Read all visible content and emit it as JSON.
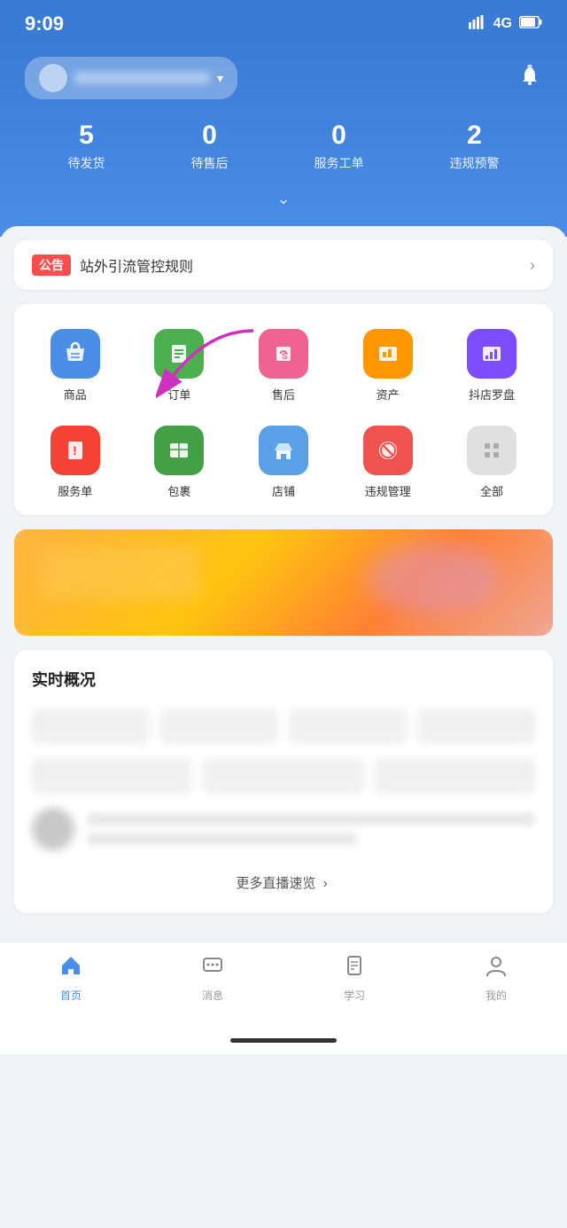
{
  "statusBar": {
    "time": "9:09",
    "network": "4G"
  },
  "header": {
    "storeName": "",
    "bellLabel": "通知",
    "stats": [
      {
        "num": "5",
        "label": "待发货"
      },
      {
        "num": "0",
        "label": "待售后"
      },
      {
        "num": "0",
        "label": "服务工单"
      },
      {
        "num": "2",
        "label": "违规预警"
      }
    ]
  },
  "announcement": {
    "badge": "公告",
    "text": "站外引流管控规则",
    "arrow": "›"
  },
  "menu": {
    "items": [
      {
        "id": "goods",
        "label": "商品",
        "iconColor": "icon-blue"
      },
      {
        "id": "orders",
        "label": "订单",
        "iconColor": "icon-green"
      },
      {
        "id": "aftersale",
        "label": "售后",
        "iconColor": "icon-pink"
      },
      {
        "id": "assets",
        "label": "资产",
        "iconColor": "icon-orange"
      },
      {
        "id": "compass",
        "label": "抖店罗盘",
        "iconColor": "icon-purple"
      },
      {
        "id": "service",
        "label": "服务单",
        "iconColor": "icon-red"
      },
      {
        "id": "parcel",
        "label": "包裹",
        "iconColor": "icon-green2"
      },
      {
        "id": "store",
        "label": "店铺",
        "iconColor": "icon-blue2"
      },
      {
        "id": "violation",
        "label": "违规管理",
        "iconColor": "icon-red2"
      },
      {
        "id": "all",
        "label": "全部",
        "iconColor": "icon-gray"
      }
    ]
  },
  "realtime": {
    "title": "实时概况"
  },
  "moreLive": {
    "text": "更多直播速览",
    "arrow": "›"
  },
  "bottomNav": [
    {
      "id": "home",
      "label": "首页",
      "active": true
    },
    {
      "id": "message",
      "label": "消息",
      "active": false
    },
    {
      "id": "learn",
      "label": "学习",
      "active": false
    },
    {
      "id": "mine",
      "label": "我的",
      "active": false
    }
  ]
}
